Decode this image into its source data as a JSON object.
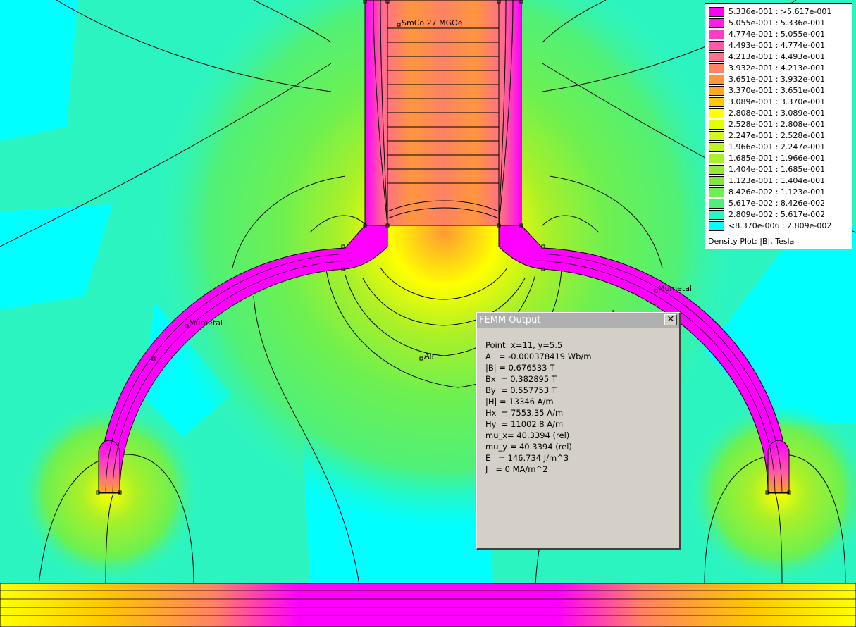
{
  "colors": {
    "background_low": "#2cf4c0",
    "air_cyan": "#00ffff",
    "magenta": "#ff00ff",
    "orange": "#ff9933",
    "yellow": "#ffff00",
    "green": "#7cf44c",
    "dialog_face": "#d4d0c8",
    "dialog_title_inactive": "#b0b0b0"
  },
  "regions": {
    "magnet_label": "SmCo 27 MGOe",
    "left_core_label": "Mumetal",
    "right_core_label": "Mumetal",
    "air_label": "Air"
  },
  "legend": {
    "title": "Density Plot: |B|, Tesla",
    "entries": [
      {
        "label": "5.336e-001 : >5.617e-001",
        "color": "#ff00ff"
      },
      {
        "label": "5.055e-001 : 5.336e-001",
        "color": "#ff1ee6"
      },
      {
        "label": "4.774e-001 : 5.055e-001",
        "color": "#ff3cc8"
      },
      {
        "label": "4.493e-001 : 4.774e-001",
        "color": "#ff5aaa"
      },
      {
        "label": "4.213e-001 : 4.493e-001",
        "color": "#ff6e8c"
      },
      {
        "label": "3.932e-001 : 4.213e-001",
        "color": "#ff8264"
      },
      {
        "label": "3.651e-001 : 3.932e-001",
        "color": "#ff963c"
      },
      {
        "label": "3.370e-001 : 3.651e-001",
        "color": "#ffaa1e"
      },
      {
        "label": "3.089e-001 : 3.370e-001",
        "color": "#ffc800"
      },
      {
        "label": "2.808e-001 : 3.089e-001",
        "color": "#ffff00"
      },
      {
        "label": "2.528e-001 : 2.808e-001",
        "color": "#e6ff00"
      },
      {
        "label": "2.247e-001 : 2.528e-001",
        "color": "#d2fa14"
      },
      {
        "label": "1.966e-001 : 2.247e-001",
        "color": "#bef51e"
      },
      {
        "label": "1.685e-001 : 1.966e-001",
        "color": "#aaf028"
      },
      {
        "label": "1.404e-001 : 1.685e-001",
        "color": "#96eb32"
      },
      {
        "label": "1.123e-001 : 1.404e-001",
        "color": "#82e63c"
      },
      {
        "label": "8.426e-002 : 1.123e-001",
        "color": "#6ef050"
      },
      {
        "label": "5.617e-002 : 8.426e-002",
        "color": "#50f078"
      },
      {
        "label": "2.809e-002 : 5.617e-002",
        "color": "#2cf4c0"
      },
      {
        "label": "<8.370e-006 : 2.809e-002",
        "color": "#00ffff"
      }
    ]
  },
  "output_window": {
    "title": "FEMM Output",
    "close_glyph": "✕",
    "lines": [
      "Point: x=11, y=5.5",
      "A   = -0.000378419 Wb/m",
      "|B| = 0.676533 T",
      "Bx  = 0.382895 T",
      "By  = 0.557753 T",
      "|H| = 13346 A/m",
      "Hx  = 7553.35 A/m",
      "Hy  = 11002.8 A/m",
      "mu_x= 40.3394 (rel)",
      "mu_y = 40.3394 (rel)",
      "E   = 146.734 J/m^3",
      "J   = 0 MA/m^2"
    ]
  }
}
